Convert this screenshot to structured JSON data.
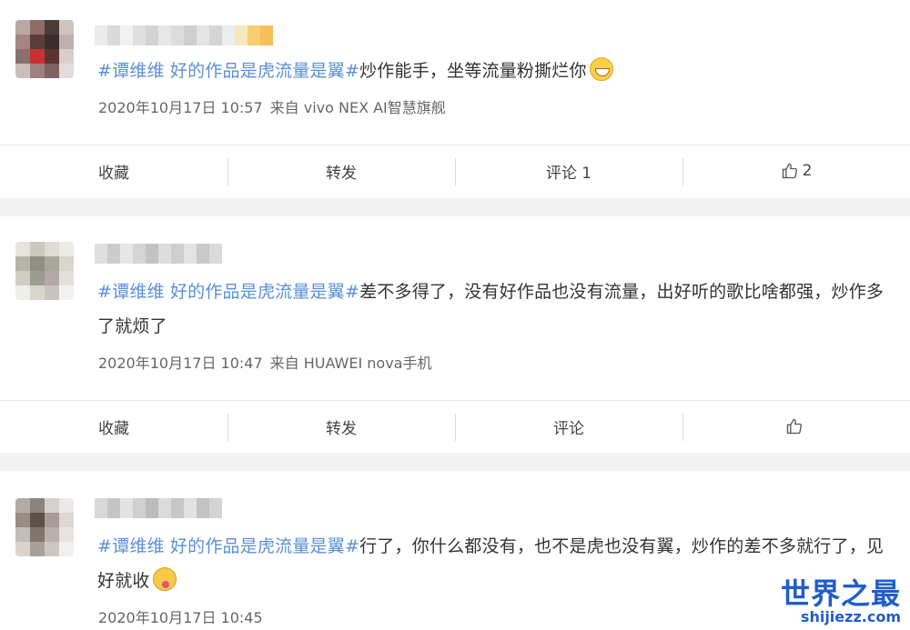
{
  "posts": [
    {
      "hashtag": "#谭维维 好的作品是虎流量是翼#",
      "body": "炒作能手，坐等流量粉撕烂你",
      "emoji": "grin-emoji",
      "time": "2020年10月17日 10:57",
      "source": "来自 vivo NEX AI智慧旗舰",
      "actions": {
        "favorite": "收藏",
        "repost": "转发",
        "comment": "评论 1",
        "like": "2"
      }
    },
    {
      "hashtag": "#谭维维 好的作品是虎流量是翼#",
      "body": "差不多得了，没有好作品也没有流量，出好听的歌比啥都强，炒作多了就烦了",
      "time": "2020年10月17日 10:47",
      "source": "来自 HUAWEI nova手机",
      "actions": {
        "favorite": "收藏",
        "repost": "转发",
        "comment": "评论",
        "like": ""
      }
    },
    {
      "hashtag": "#谭维维 好的作品是虎流量是翼#",
      "body": "行了，你什么都没有，也不是虎也没有翼，炒作的差不多就行了，见好就收",
      "emoji": "yum-emoji",
      "time": "2020年10月17日 10:45"
    }
  ],
  "watermark": {
    "main": "世界之最",
    "sub": "shijiezz.com"
  },
  "colors": {
    "hashtag": "#5b8fd6",
    "watermark": "#1f5ec9",
    "gap": "#f2f2f2"
  }
}
